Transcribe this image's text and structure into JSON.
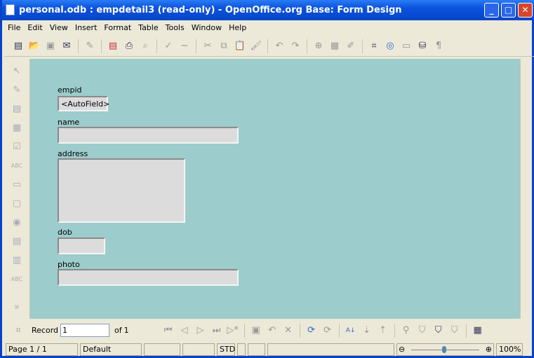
{
  "window": {
    "title": "personal.odb : empdetail3 (read-only) - OpenOffice.org Base: Form Design",
    "min": "_",
    "max": "□",
    "close": "✕"
  },
  "menu": [
    "File",
    "Edit",
    "View",
    "Insert",
    "Format",
    "Table",
    "Tools",
    "Window",
    "Help"
  ],
  "form": {
    "fields": [
      {
        "label": "empid",
        "value": "<AutoField>"
      },
      {
        "label": "name",
        "value": ""
      },
      {
        "label": "address",
        "value": ""
      },
      {
        "label": "dob",
        "value": ""
      },
      {
        "label": "photo",
        "value": ""
      }
    ]
  },
  "nav": {
    "record_label": "Record",
    "record_value": "1",
    "of_label": "of",
    "total": "1"
  },
  "status": {
    "page": "Page 1 / 1",
    "style": "Default",
    "mode": "STD",
    "zoom": "100%",
    "zoom_level": 100
  },
  "colors": {
    "canvas": "#9ccccc",
    "title": "#0a52dd"
  }
}
